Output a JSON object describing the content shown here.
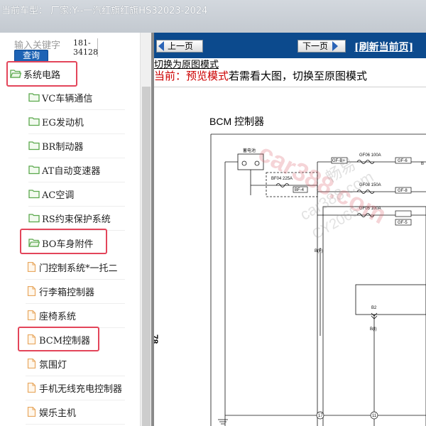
{
  "header": {
    "title": "当前车型： 厂家:Y--一汽红旗红旗HS32023-2024"
  },
  "search": {
    "placeholder": "输入关键字",
    "button_label": "查询",
    "code": "181-34128"
  },
  "sidebar": {
    "items": [
      {
        "label": "系统电路",
        "icon": "folder-open-icon"
      },
      {
        "label": "VC车辆通信",
        "icon": "folder-icon"
      },
      {
        "label": "EG发动机",
        "icon": "folder-icon"
      },
      {
        "label": "BR制动器",
        "icon": "folder-icon"
      },
      {
        "label": "AT自动变速器",
        "icon": "folder-icon"
      },
      {
        "label": "AC空调",
        "icon": "folder-icon"
      },
      {
        "label": "RS约束保护系统",
        "icon": "folder-icon"
      },
      {
        "label": "BO车身附件",
        "icon": "folder-open-icon"
      },
      {
        "label": "门控制系统*一托二",
        "icon": "document-icon"
      },
      {
        "label": "行李箱控制器",
        "icon": "document-icon"
      },
      {
        "label": "座椅系统",
        "icon": "document-icon"
      },
      {
        "label": "BCM控制器",
        "icon": "document-icon"
      },
      {
        "label": "氛围灯",
        "icon": "document-icon"
      },
      {
        "label": "手机无线充电控制器",
        "icon": "document-icon"
      },
      {
        "label": "娱乐主机",
        "icon": "document-icon"
      }
    ]
  },
  "nav": {
    "prev_label": "上一页",
    "next_label": "下一页",
    "refresh_label": "[刷新当前页]"
  },
  "viewer": {
    "switch_link": "切换为原图模式",
    "mode_prefix": "当前：",
    "mode_name": "预览模式",
    "mode_hint": "若需看大图，切换至原图模式"
  },
  "diagram": {
    "title": "BCM 控制器",
    "page_number": "78",
    "labels": {
      "battery": "蓄电池",
      "fuse_box": "BF04 225A",
      "bf4": "BF-4",
      "gf_b": "GF-B+",
      "gf06": "GF06 100A",
      "gf6": "GF-6",
      "gf08": "GF08 150A",
      "gf8": "GF-8",
      "gf05": "GF05 100A",
      "gf5": "GF-5",
      "bf": "B(F)",
      "b2": "B2",
      "bi": "B(I)",
      "c17": "17",
      "c11": "11",
      "b_end": "B"
    },
    "watermark": {
      "main": "car388.com",
      "sub1": "car388.com",
      "sub2": "CY2065",
      "cn": "畅易"
    }
  },
  "colors": {
    "nav_bg": "#0c4a8d",
    "highlight": "#e3455a",
    "folder": "#5aa84c",
    "document": "#e8a860",
    "search_button": "#1d63b5"
  }
}
